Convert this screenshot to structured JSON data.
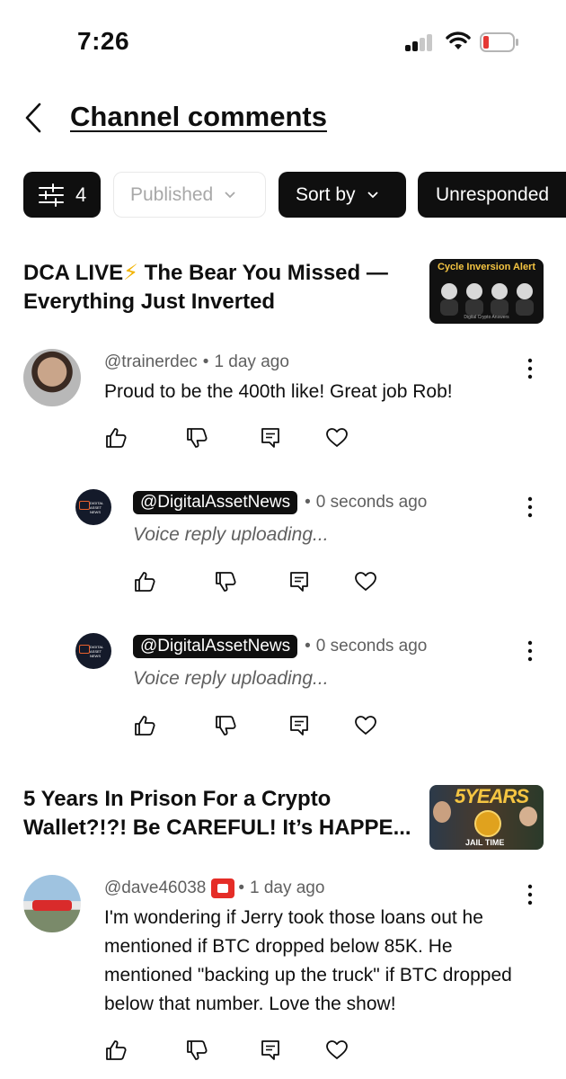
{
  "status_bar": {
    "time": "7:26"
  },
  "header": {
    "title": "Channel comments"
  },
  "filters": {
    "filter_count": "4",
    "published_label": "Published",
    "sort_label": "Sort by",
    "unresponded_label": "Unresponded"
  },
  "videos": [
    {
      "title_part1": "DCA LIVE",
      "title_bolt": "⚡",
      "title_part2": " The Bear You Missed — Everything Just Inverted",
      "thumb_text": "Cycle Inversion Alert",
      "thumb_subtext": "Digital Crypto Answers",
      "comment": {
        "handle": "@trainerdec",
        "time": "1 day ago",
        "text": "Proud to be the 400th like! Great job Rob!"
      },
      "replies": [
        {
          "handle": "@DigitalAssetNews",
          "time": "0 seconds ago",
          "text": "Voice reply uploading..."
        },
        {
          "handle": "@DigitalAssetNews",
          "time": "0 seconds ago",
          "text": "Voice reply uploading..."
        }
      ]
    },
    {
      "title": "5 Years In Prison For a Crypto Wallet?!?! Be CAREFUL! It’s HAPPE...",
      "thumb_text": "5YEARS",
      "thumb_subtext": "JAIL TIME",
      "comment": {
        "handle": "@dave46038",
        "time": "1 day ago",
        "text": "I'm wondering if Jerry took those loans out he mentioned if BTC dropped below 85K.  He mentioned \"backing up the truck\" if BTC dropped below that number.   Love the show!"
      }
    }
  ],
  "avatar_badge_text": "DIGITAL ASSET NEWS",
  "icons": [
    "back-icon",
    "filter-sliders-icon",
    "chevron-down-icon",
    "thumbs-up-icon",
    "thumbs-down-icon",
    "reply-icon",
    "heart-icon",
    "more-vert-icon"
  ]
}
